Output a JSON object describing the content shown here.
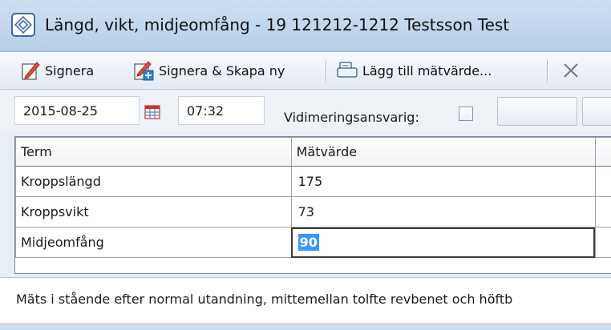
{
  "window": {
    "title": "Längd, vikt, midjeomfång -  19 121212-1212 Testsson Test"
  },
  "toolbar": {
    "sign_label": "Signera",
    "sign_new_label": "Signera & Skapa ny",
    "add_value_label": "Lägg till mätvärde...",
    "close_icon": "close-icon"
  },
  "dateRow": {
    "date": "2015-08-25",
    "time": "07:32",
    "vidimering_label": "Vidimeringsansvarig:",
    "vidimering_checked": false
  },
  "grid": {
    "headers": [
      "Term",
      "Mätvärde"
    ],
    "rows": [
      {
        "term": "Kroppslängd",
        "value": "175"
      },
      {
        "term": "Kroppsvikt",
        "value": "73"
      },
      {
        "term": "Midjeomfång",
        "value": "90"
      }
    ],
    "active_row": 2
  },
  "description": "Mäts i stående efter normal utandning, mittemellan tolfte revbenet och höftb",
  "colors": {
    "title_bar": "#c2d6ec",
    "selection": "#3399ff",
    "calendar_red": "#d8302b"
  }
}
